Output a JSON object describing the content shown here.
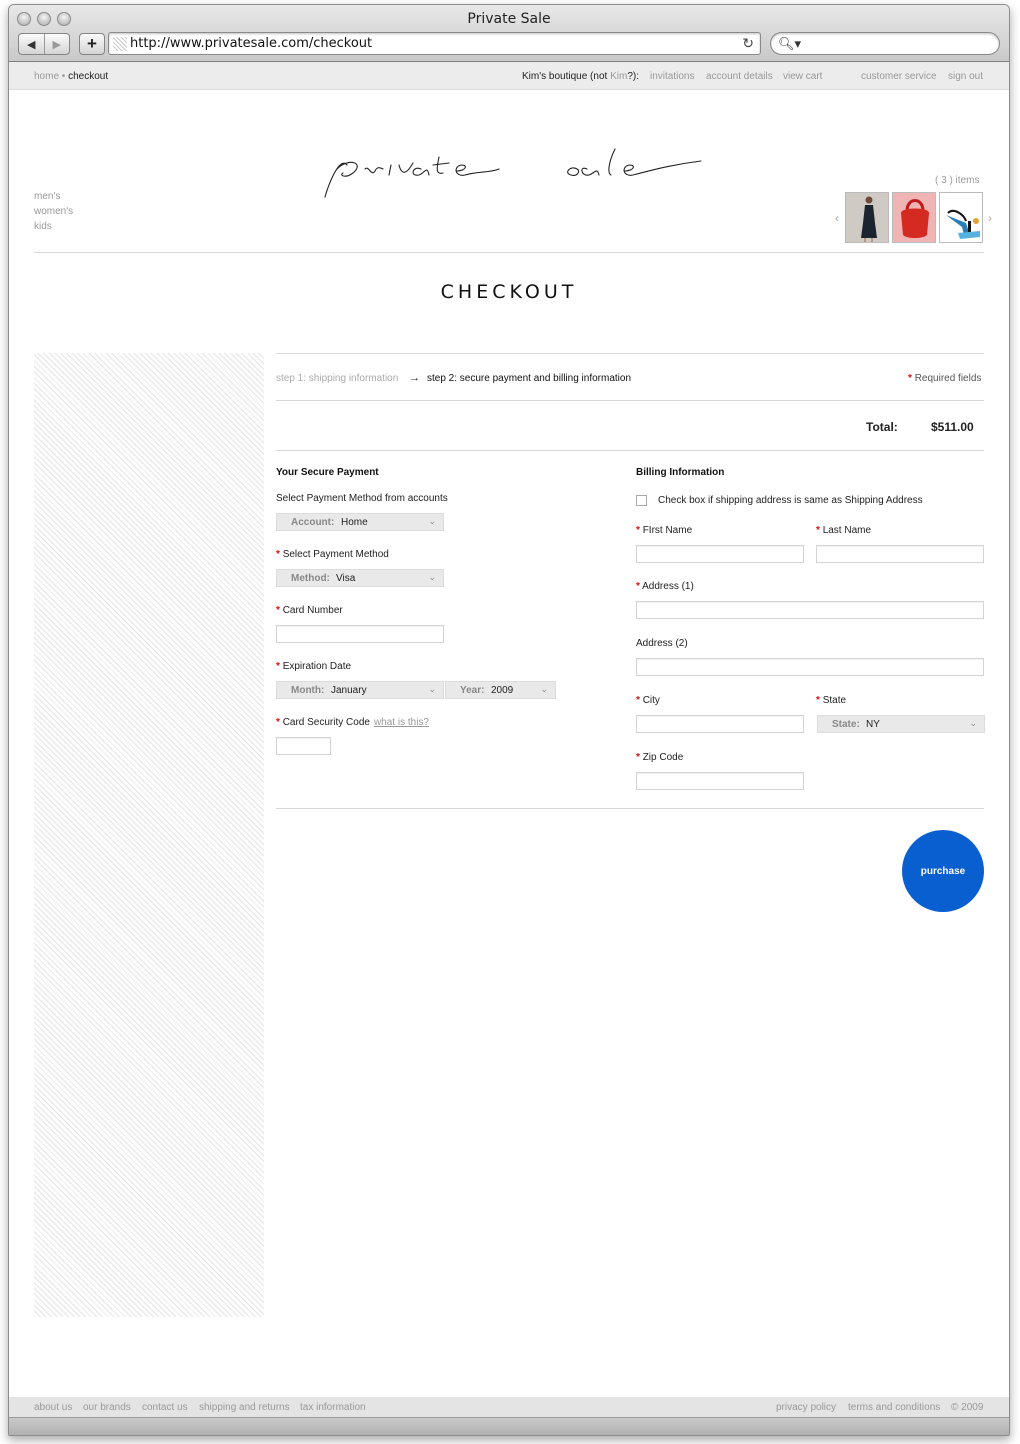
{
  "window": {
    "title": "Private Sale",
    "url": "http://www.privatesale.com/checkout",
    "back_glyph": "◀",
    "forward_glyph": "▶",
    "add_glyph": "+",
    "reload_glyph": "↻",
    "search_glyph": "🔍︎▾"
  },
  "topbar": {
    "breadcrumb_home": "home",
    "breadcrumb_separator": "•",
    "breadcrumb_current": "checkout",
    "boutique_prefix": "Kim's boutique (not ",
    "boutique_name": "Kim",
    "boutique_suffix": "?):",
    "links": [
      "invitations",
      "account details",
      "view cart",
      "customer service",
      "sign out"
    ]
  },
  "header": {
    "logo_text": "private sale",
    "nav": [
      "men's",
      "women's",
      "kids"
    ],
    "items_count": "( 3 ) items",
    "carousel_prev": "‹",
    "carousel_next": "›",
    "thumbnails": [
      "dress",
      "handbag",
      "heels"
    ]
  },
  "page": {
    "heading": "CHECKOUT"
  },
  "steps": {
    "step1": "step 1: shipping information",
    "arrow": "→",
    "step2": "step 2: secure payment and billing information",
    "required_star": "*",
    "required_note": "Required fields"
  },
  "total": {
    "label": "Total:",
    "value": "$511.00"
  },
  "payment": {
    "title": "Your Secure Payment",
    "accounts_label": "Select Payment Method from accounts",
    "account_prefix": "Account:",
    "account_value": "Home",
    "method_label": "Select Payment Method",
    "method_prefix": "Method:",
    "method_value": "Visa",
    "card_number_label": "Card Number",
    "card_number_value": "",
    "expiration_label": "Expiration Date",
    "month_prefix": "Month:",
    "month_value": "January",
    "year_prefix": "Year:",
    "year_value": "2009",
    "security_label": "Card Security Code",
    "security_link": "what is this?",
    "security_value": ""
  },
  "billing": {
    "title": "Billing Information",
    "same_address_label": "Check box if shipping address is same as Shipping Address",
    "same_address_checked": false,
    "first_name_label": "FIrst Name",
    "last_name_label": "Last Name",
    "address1_label": "Address (1)",
    "address2_label": "Address (2)",
    "city_label": "City",
    "state_label": "State",
    "state_prefix": "State:",
    "state_value": "NY",
    "zip_label": "Zip Code"
  },
  "purchase_label": "purchase",
  "footer": {
    "left_links": [
      "about us",
      "our brands",
      "contact us",
      "shipping and returns",
      "tax information"
    ],
    "right_links": [
      "privacy policy",
      "terms and conditions",
      "© 2009"
    ]
  },
  "colors": {
    "accent": "#0a5fd0",
    "required": "#dd1111",
    "muted_text": "#999999"
  }
}
